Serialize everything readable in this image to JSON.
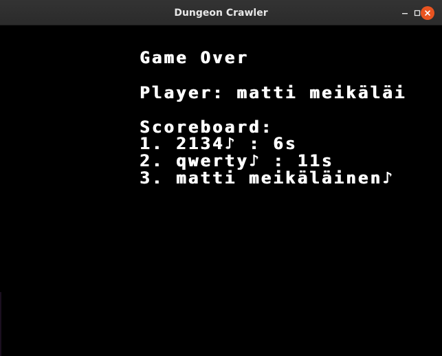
{
  "window": {
    "title": "Dungeon Crawler",
    "close_button_color": "#e95420"
  },
  "game": {
    "heading": "Game Over",
    "player_line": "Player: matti meikäläi",
    "scoreboard_label": "Scoreboard:",
    "scoreboard": [
      "1. 2134♪ : 6s",
      "2. qwerty♪ : 11s",
      "3. matti meikäläinen♪"
    ]
  }
}
